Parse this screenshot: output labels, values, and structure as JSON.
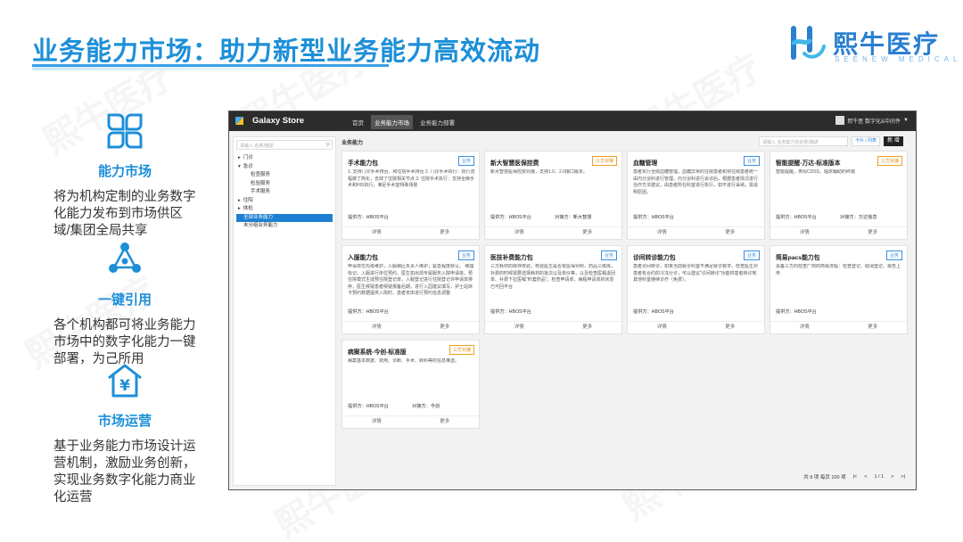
{
  "header": {
    "title": "业务能力市场：助力新型业务能力高效流动",
    "logo_text": "熙牛医疗",
    "logo_sub": "SEENEW MEDICAL",
    "watermark": "熙牛医疗"
  },
  "features": [
    {
      "icon": "grid-icon",
      "title": "能力市场",
      "desc": "将为机构定制的业务数字化能力发布到市场供区域/集团全局共享"
    },
    {
      "icon": "network-icon",
      "title": "一键引用",
      "desc": "各个机构都可将业务能力市场中的数字化能力一键部署，为己所用"
    },
    {
      "icon": "yuan-house-icon",
      "title": "市场运营",
      "desc": "基于业务能力市场设计运营机制，激励业务创新，实现业务数字化能力商业化运营"
    }
  ],
  "app": {
    "name": "Galaxy Store",
    "nav": [
      "首页",
      "业务能力市场",
      "业务能力部署"
    ],
    "nav_active": 1,
    "user": "熙牛医 数字化&中间件",
    "sidebar_search_placeholder": "请输入 名称/描述",
    "tree": [
      {
        "label": "门诊",
        "level": 1,
        "arrow": "▸"
      },
      {
        "label": "急诊",
        "level": 1,
        "arrow": "▾"
      },
      {
        "label": "检查服务",
        "level": 2
      },
      {
        "label": "检验服务",
        "level": 2
      },
      {
        "label": "手术服务",
        "level": 2
      },
      {
        "label": "住院",
        "level": 1,
        "arrow": "▸"
      },
      {
        "label": "体检",
        "level": 1,
        "arrow": "▸"
      },
      {
        "label": "全部业务能力",
        "level": 0,
        "selected": true
      },
      {
        "label": "未分组业务能力",
        "level": 0
      }
    ],
    "category": "业务能力",
    "main_search_placeholder": "请输入 业务能力包名称/描述",
    "view_toggle": "卡片 | 列表",
    "new_label": "新 增",
    "details_label": "详情",
    "more_label": "更多",
    "provider_prefix": "提供方：",
    "consumer_prefix": "对接方：",
    "cards": [
      {
        "title": "手术能力包",
        "tag": "业务",
        "tag_type": "biz",
        "desc": "1. 支持门诊手术排台、和住院手术排台\n2. 门诊手术执行：执行流程做了简化，去掉了住院相关节点\n3. 住院手术执行：支持全麻手术和HIS执行，满足手术室特殊场景",
        "provider": "HBOS平台",
        "consumer": ""
      },
      {
        "title": "新大智慧医保控费",
        "tag": "三方对接",
        "tag_type": "third",
        "desc": "新大智慧医保控费对接，支持1.0、2.0接口版本。",
        "provider": "HBOS平台",
        "consumer": "新大智慧"
      },
      {
        "title": "血糖管理",
        "tag": "业务",
        "tag_type": "biz",
        "desc": "患者实行全院血糖管理，血糖异常的住院患者和预住院患者统一由内分泌科进行管理，内分泌科进行会诊后，根据患者情况进行治疗方法建议，由患者所在科室进行执行，如不进行采纳，需说明原因。",
        "provider": "HBOS平台",
        "consumer": ""
      },
      {
        "title": "智能提醒-万达-标准版本",
        "tag": "三方对接",
        "tag_type": "third",
        "desc": "智能提醒，类似CDSS，临床辅助的终端",
        "provider": "HBOS平台",
        "consumer": "万达信息"
      },
      {
        "title": "入服能力包",
        "tag": "业务",
        "tag_type": "biz",
        "desc": "申请单优先级维护，入服病区负责人维护；紧急程度默认。 维護标记。入服进行床位预约、医生如出现专属服务入院申请单。预住院模式生成预住院登记单，入服登记进行住院登记许申请单排序，医生候疑患者候疑报备后期，进行入园建议填写。护士站床卡预约数据提供入院时，患者安床进行预约信息调整",
        "provider": "HBOS平台",
        "consumer": ""
      },
      {
        "title": "医技补费能力包",
        "tag": "业务",
        "tag_type": "biz",
        "desc": "三方耗材的库存校验，校验医生是否有医保对照，药品三级库，补费的时候需要选择耗材的批次以及单价等，以及检查医嘱退回单。补费下拉医嘱\"料套药品\"，检查申请单，病程申请单的状态已可回平台",
        "provider": "HBOS平台",
        "consumer": ""
      },
      {
        "title": "诊间转诊能力包",
        "tag": "业务",
        "tag_type": "biz",
        "desc": "患者诊间转诊，如果当前就诊科室不满足就诊要求，检查医生对患者有合约的冷冻分诊，可以建议\"诊间转诊\"功能将患者转诊到其他科室继续诊疗（免费）。",
        "provider": "HBOS平台",
        "consumer": ""
      },
      {
        "title": "简易pacs能力包",
        "tag": "业务",
        "tag_type": "biz",
        "desc": "具备三方的检查厂商的简易流程：检查登记、取消登记、报告上传",
        "provider": "HBOS平台",
        "consumer": ""
      },
      {
        "title": "病案系统-今创-标准版",
        "tag": "三方对接",
        "tag_type": "third",
        "desc": "病案基本数据、费用、诊断、手术、转科等的信息推送。",
        "provider": "HBOS平台",
        "consumer": "今创"
      }
    ],
    "pager": {
      "total": "共 9 项  每页 100 项",
      "first": "|<",
      "prev": "<",
      "page": "1 / 1",
      "next": ">",
      "last": ">|"
    }
  }
}
